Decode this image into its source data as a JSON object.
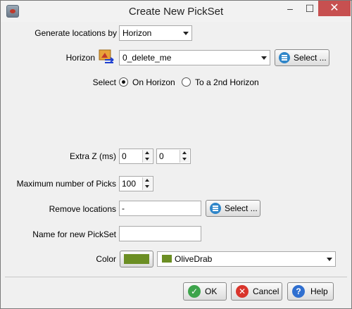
{
  "window": {
    "title": "Create New PickSet",
    "minimize": "–",
    "maximize": "☐",
    "close": "✕"
  },
  "generate": {
    "label": "Generate locations by",
    "value": "Horizon"
  },
  "horizon": {
    "label": "Horizon",
    "value": "0_delete_me",
    "select_button": "Select ..."
  },
  "select_mode": {
    "label": "Select",
    "options": [
      "On Horizon",
      "To a 2nd Horizon"
    ],
    "selected": "On Horizon"
  },
  "extra_z": {
    "label": "Extra Z (ms)",
    "value1": "0",
    "value2": "0"
  },
  "max_picks": {
    "label": "Maximum number of Picks",
    "value": "100"
  },
  "remove_locations": {
    "label": "Remove locations",
    "value": "-",
    "select_button": "Select ..."
  },
  "name": {
    "label": "Name for new PickSet",
    "value": ""
  },
  "color": {
    "label": "Color",
    "value": "OliveDrab",
    "swatch": "#6b8e23"
  },
  "footer": {
    "ok": "OK",
    "cancel": "Cancel",
    "help": "Help"
  }
}
